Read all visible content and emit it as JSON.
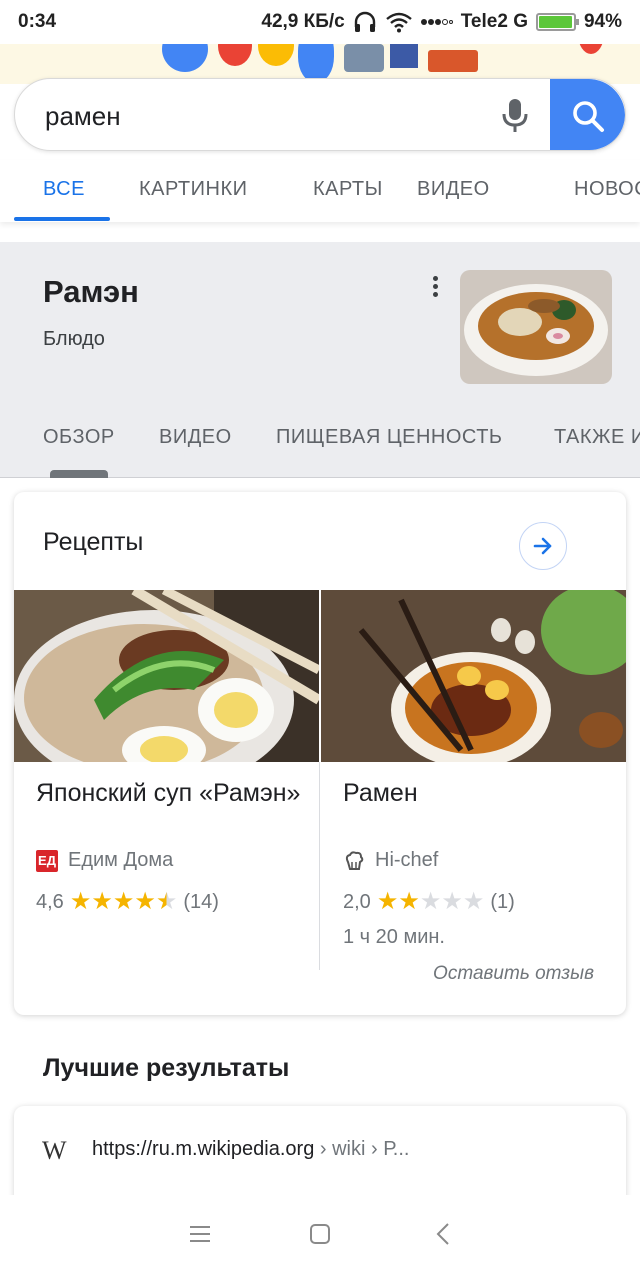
{
  "status_bar": {
    "time": "0:34",
    "speed": "42,9 КБ/с",
    "carrier": "Tele2 G",
    "battery": "94%"
  },
  "search": {
    "query": "рамен"
  },
  "tabs": [
    {
      "label": "ВСЕ",
      "active": true
    },
    {
      "label": "КАРТИНКИ",
      "active": false
    },
    {
      "label": "КАРТЫ",
      "active": false
    },
    {
      "label": "ВИДЕО",
      "active": false
    },
    {
      "label": "НОВОСТИ",
      "active": false
    }
  ],
  "knowledge_panel": {
    "title": "Рамэн",
    "subtitle": "Блюдо",
    "tabs": [
      "ОБЗОР",
      "ВИДЕО",
      "ПИЩЕВАЯ ЦЕННОСТЬ",
      "ТАКЖЕ ИЩУТ"
    ]
  },
  "recipes": {
    "heading": "Рецепты",
    "items": [
      {
        "name": "Японский суп «Рамэн»",
        "source": "Едим Дома",
        "source_icon": "ЕД",
        "rating": "4,6",
        "stars": 4.5,
        "reviews": "(14)",
        "time": ""
      },
      {
        "name": "Рамен",
        "source": "Hi-chef",
        "source_icon": "chef-hat-icon",
        "rating": "2,0",
        "stars": 2,
        "reviews": "(1)",
        "time": "1 ч 20 мин."
      }
    ],
    "review_link": "Оставить отзыв"
  },
  "best_results": {
    "heading": "Лучшие результаты",
    "first": {
      "site_icon": "W",
      "url": "https://ru.m.wikipedia.org",
      "crumbs": " › wiki › Р..."
    }
  },
  "colors": {
    "accent": "#1a73e8",
    "search_button": "#4285f4",
    "star": "#f5b400",
    "battery": "#5cc73a"
  }
}
